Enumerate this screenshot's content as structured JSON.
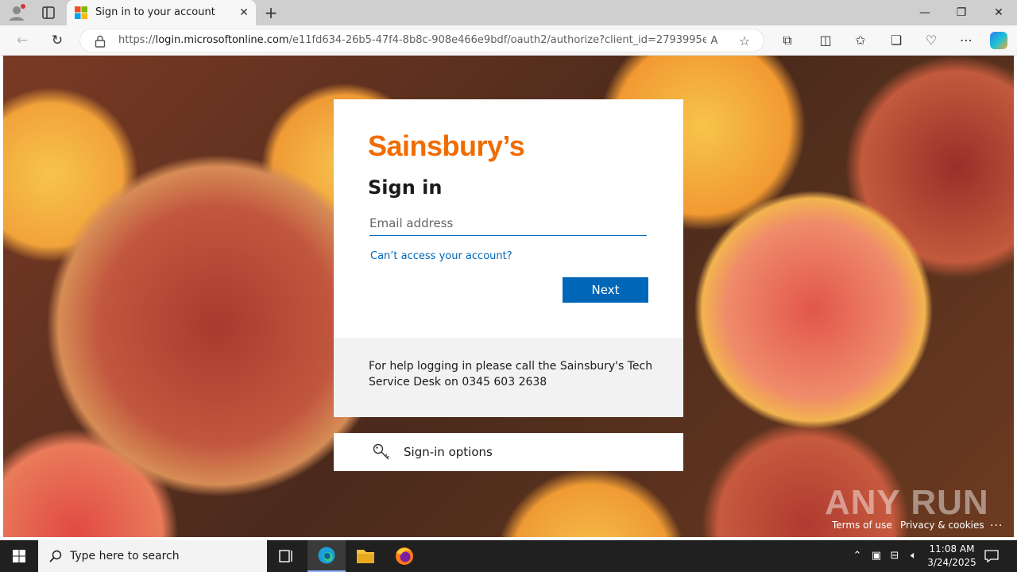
{
  "browser": {
    "tab_title": "Sign in to your account",
    "url_prefix": "https://",
    "url_domain": "login.microsoftonline.com",
    "url_rest": "/e11fd634-26b5-47f4-8b8c-908e466e9bdf/oauth2/authorize?client_id=2793995e-..."
  },
  "card": {
    "logo_text": "Sainsbury’s",
    "heading": "Sign in",
    "email_placeholder": "Email address",
    "cant_access": "Can’t access your account?",
    "next_label": "Next"
  },
  "help": {
    "text": "For help logging in please call the Sainsbury's Tech Service Desk on 0345 603 2638"
  },
  "signin_options": {
    "label": "Sign-in options"
  },
  "footer": {
    "terms": "Terms of use",
    "privacy": "Privacy & cookies",
    "more": "..."
  },
  "watermark": "ANY RUN",
  "taskbar": {
    "search_placeholder": "Type here to search",
    "time": "11:08 AM",
    "date": "3/24/2025"
  },
  "colors": {
    "brand_orange": "#f06c00",
    "accent_blue": "#0067b8"
  }
}
